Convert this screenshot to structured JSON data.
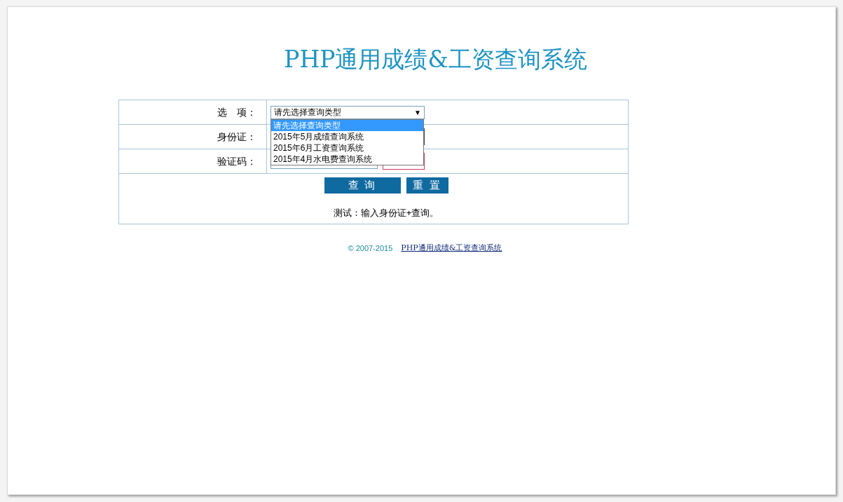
{
  "title": "PHP通用成绩&工资查询系统",
  "form": {
    "type_label": "选　项：",
    "type_select": {
      "value": "请先选择查询类型",
      "arrow": "▼",
      "expanded": true,
      "options": [
        {
          "label": "请先选择查询类型",
          "selected": true
        },
        {
          "label": "2015年5月成绩查询系统",
          "selected": false
        },
        {
          "label": "2015年6月工资查询系统",
          "selected": false
        },
        {
          "label": "2015年4月水电费查询系统",
          "selected": false
        }
      ]
    },
    "id_label": "身份证：",
    "captcha_label": "验证码：",
    "buttons": [
      "查 询",
      "重 置"
    ],
    "note": "测试：输入身份证+查询。"
  },
  "footer": {
    "copyright": "© 2007-2015",
    "link": "PHP通用成绩&工资查询系统"
  }
}
